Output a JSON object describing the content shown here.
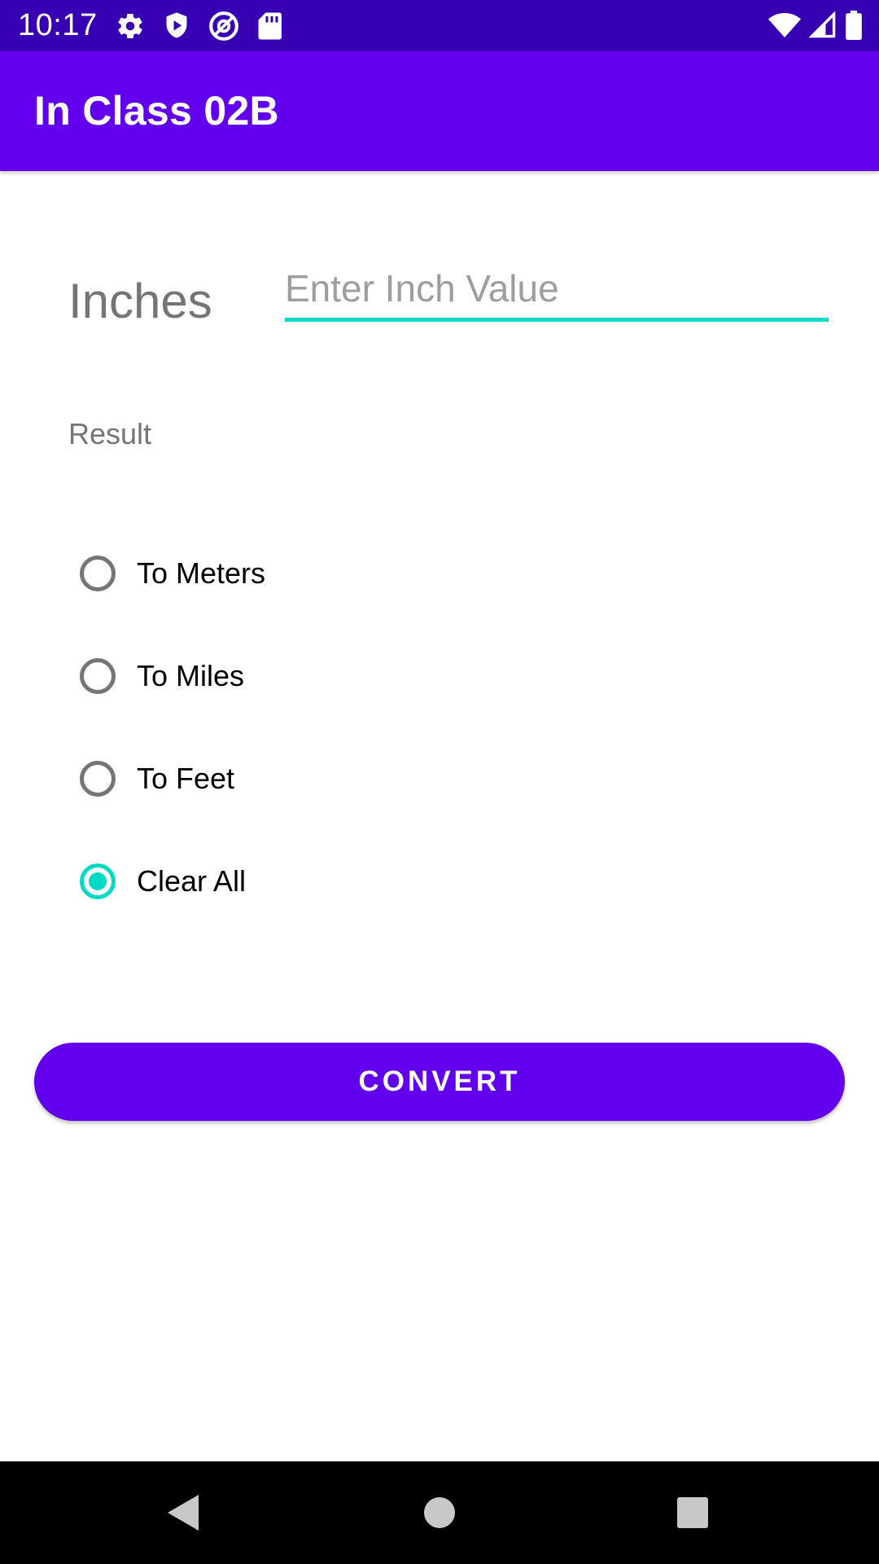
{
  "status_bar": {
    "time": "10:17",
    "left_icons": [
      "settings-icon",
      "shield-play-icon",
      "at-sign-icon",
      "sd-card-icon"
    ],
    "right_icons": [
      "wifi-icon",
      "cell-signal-icon",
      "battery-icon"
    ]
  },
  "app_bar": {
    "title": "In Class 02B"
  },
  "form": {
    "inches_label": "Inches",
    "inch_input_value": "",
    "inch_input_placeholder": "Enter Inch Value",
    "result_text": "Result"
  },
  "options": {
    "items": [
      {
        "label": "To Meters",
        "checked": false
      },
      {
        "label": "To Miles",
        "checked": false
      },
      {
        "label": "To Feet",
        "checked": false
      },
      {
        "label": "Clear All",
        "checked": true
      }
    ]
  },
  "actions": {
    "convert_label": "CONVERT"
  },
  "nav_bar": {
    "icons": [
      "back-icon",
      "home-icon",
      "recents-icon"
    ]
  },
  "colors": {
    "status_bar": "#3700B3",
    "primary": "#6200EE",
    "accent": "#03DAC5",
    "secondary_text": "#757575"
  }
}
